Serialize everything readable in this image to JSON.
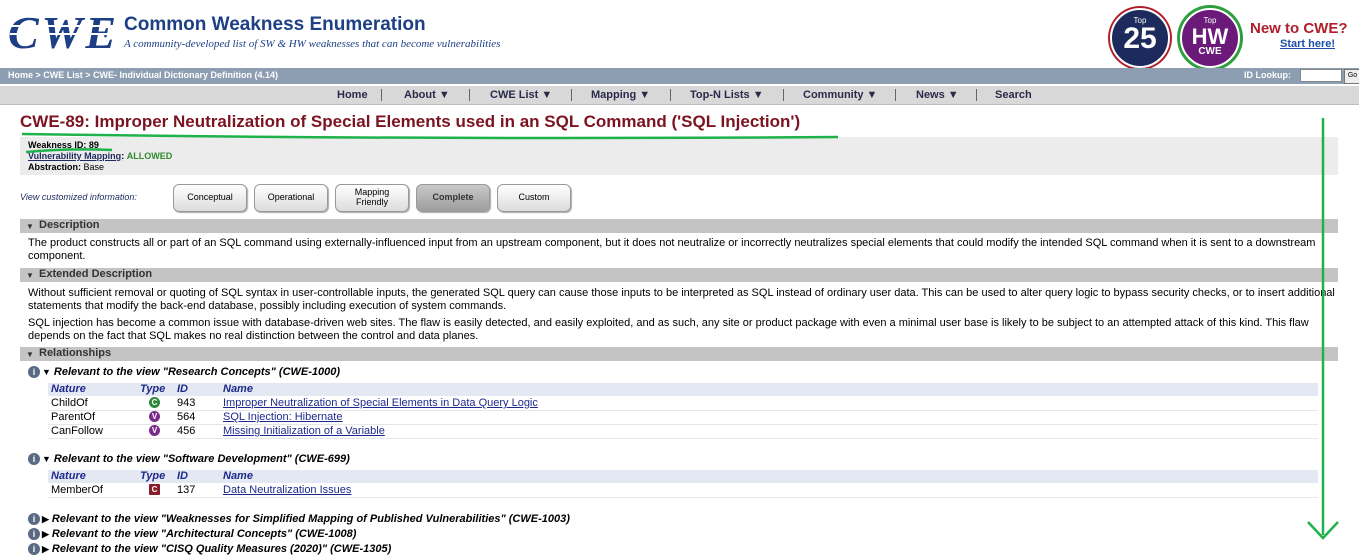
{
  "header": {
    "logo_text": "CWE",
    "site_title": "Common Weakness Enumeration",
    "tagline": "A community-developed list of SW & HW weaknesses that can become vulnerabilities",
    "badge_top25": {
      "top": "Top",
      "number": "25"
    },
    "badge_hw": {
      "top": "Top",
      "big": "HW",
      "small": "CWE"
    },
    "new_to_cwe": "New to CWE?",
    "start_here": "Start here!"
  },
  "breadcrumb": "Home > CWE List > CWE- Individual Dictionary Definition (4.14)",
  "id_lookup": {
    "label": "ID Lookup:",
    "value": "",
    "go": "Go"
  },
  "nav": {
    "home": "Home",
    "about": "About ▼",
    "cwe_list": "CWE List ▼",
    "mapping": "Mapping ▼",
    "top_n": "Top-N Lists ▼",
    "community": "Community ▼",
    "news": "News ▼",
    "search": "Search"
  },
  "title": "CWE-89: Improper Neutralization of Special Elements used in an SQL Command ('SQL Injection')",
  "meta": {
    "weakness_id_label": "Weakness ID:",
    "weakness_id": "89",
    "vuln_mapping_label": "Vulnerability Mapping",
    "vuln_mapping_value": "ALLOWED",
    "abstraction_label": "Abstraction:",
    "abstraction": "Base"
  },
  "views": {
    "label": "View customized information:",
    "conceptual": "Conceptual",
    "operational": "Operational",
    "mapping_1": "Mapping",
    "mapping_2": "Friendly",
    "complete": "Complete",
    "custom": "Custom",
    "active": "Complete"
  },
  "sections": {
    "description": "Description",
    "extended": "Extended Description",
    "relationships": "Relationships"
  },
  "description_text": "The product constructs all or part of an SQL command using externally-influenced input from an upstream component, but it does not neutralize or incorrectly neutralizes special elements that could modify the intended SQL command when it is sent to a downstream component.",
  "extended_text_1": "Without sufficient removal or quoting of SQL syntax in user-controllable inputs, the generated SQL query can cause those inputs to be interpreted as SQL instead of ordinary user data. This can be used to alter query logic to bypass security checks, or to insert additional statements that modify the back-end database, possibly including execution of system commands.",
  "extended_text_2": "SQL injection has become a common issue with database-driven web sites. The flaw is easily detected, and easily exploited, and as such, any site or product package with even a minimal user base is likely to be subject to an attempted attack of this kind. This flaw depends on the fact that SQL makes no real distinction between the control and data planes.",
  "table_headers": {
    "nature": "Nature",
    "type": "Type",
    "id": "ID",
    "name": "Name"
  },
  "rel_views": {
    "research": "Relevant to the view \"Research Concepts\" (CWE-1000)",
    "software": "Relevant to the view \"Software Development\" (CWE-699)",
    "simplified": "Relevant to the view \"Weaknesses for Simplified Mapping of Published Vulnerabilities\" (CWE-1003)",
    "architectural": "Relevant to the view \"Architectural Concepts\" (CWE-1008)",
    "cisq": "Relevant to the view \"CISQ Quality Measures (2020)\" (CWE-1305)"
  },
  "research_rows": [
    {
      "nature": "ChildOf",
      "type": "C",
      "id": "943",
      "name": "Improper Neutralization of Special Elements in Data Query Logic"
    },
    {
      "nature": "ParentOf",
      "type": "V",
      "id": "564",
      "name": "SQL Injection: Hibernate"
    },
    {
      "nature": "CanFollow",
      "type": "V",
      "id": "456",
      "name": "Missing Initialization of a Variable"
    }
  ],
  "software_rows": [
    {
      "nature": "MemberOf",
      "type": "C",
      "id": "137",
      "name": "Data Neutralization Issues"
    }
  ],
  "colors": {
    "title": "#7b1420",
    "annotation": "#1fb24a",
    "nav_bg": "#d8d8d8",
    "breadcrumb_bg": "#8d9db2"
  }
}
